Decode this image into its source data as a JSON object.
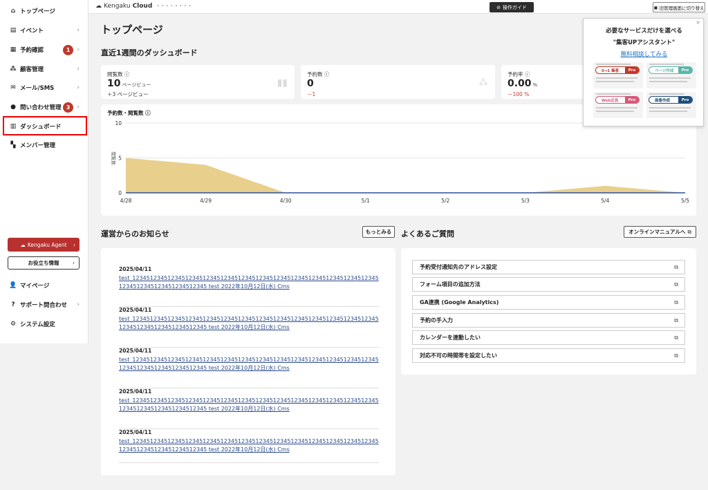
{
  "sidebar": {
    "items": [
      {
        "label": "トップページ",
        "icon": "home-icon"
      },
      {
        "label": "イベント",
        "icon": "document-icon"
      },
      {
        "label": "予約確認",
        "icon": "calendar-icon",
        "badge": "1"
      },
      {
        "label": "顧客管理",
        "icon": "users-icon"
      },
      {
        "label": "メール/SMS",
        "icon": "mail-icon"
      },
      {
        "label": "問い合わせ管理",
        "icon": "chat-icon",
        "badge": "3"
      },
      {
        "label": "ダッシュボード",
        "icon": "chart-icon"
      },
      {
        "label": "メンバー管理",
        "icon": "grid-icon"
      }
    ],
    "agent_label": "Kengaku Agent",
    "useful_label": "お役立ち情報",
    "bottom_items": [
      {
        "label": "マイページ",
        "icon": "person-icon"
      },
      {
        "label": "サポート問合わせ",
        "icon": "help-icon"
      },
      {
        "label": "システム設定",
        "icon": "gear-icon"
      }
    ]
  },
  "topbar": {
    "logo_text": "Kengaku",
    "logo_bold": "Cloud",
    "logo_small": "• • • • • • • •",
    "guide_label": "操作ガイド",
    "switch_label": "旧管理画面に切り替え"
  },
  "main": {
    "page_title": "トップページ",
    "dashboard_title": "直近1週間のダッシュボード",
    "stats": [
      {
        "label": "閲覧数 ⓘ",
        "value": "10",
        "unit": "ページビュー",
        "diff": "＋3 ページビュー",
        "negative": false
      },
      {
        "label": "予約数 ⓘ",
        "value": "0",
        "unit": "",
        "diff": "－1",
        "negative": true
      },
      {
        "label": "予約率 ⓘ",
        "value": "0.00",
        "unit": "%",
        "diff": "－100 %",
        "negative": true
      }
    ],
    "chart_title": "予約数・閲覧数 ⓘ",
    "news_title": "運営からのお知らせ",
    "news_more": "もっとみる",
    "news": [
      {
        "date": "2025/04/11",
        "text": "test_12345123451234512345123451234512345123451234512345123451234512345123451234512345123451234512345 test 2022年10月12日(水) Cms"
      },
      {
        "date": "2025/04/11",
        "text": "test_12345123451234512345123451234512345123451234512345123451234512345123451234512345123451234512345 test 2022年10月12日(水) Cms"
      },
      {
        "date": "2025/04/11",
        "text": "test_12345123451234512345123451234512345123451234512345123451234512345123451234512345123451234512345 test 2022年10月12日(水) Cms"
      },
      {
        "date": "2025/04/11",
        "text": "test_12345123451234512345123451234512345123451234512345123451234512345123451234512345123451234512345 test 2022年10月12日(水) Cms"
      },
      {
        "date": "2025/04/11",
        "text": "test_12345123451234512345123451234512345123451234512345123451234512345123451234512345123451234512345 test 2022年10月12日(水) Cms"
      }
    ],
    "faq_title": "よくあるご質問",
    "manual_label": "オンラインマニュアルへ",
    "faq": [
      "予約受付通知先のアドレス設定",
      "フォーム項目の追加方法",
      "GA連携 (Google Analytics)",
      "予約の手入力",
      "カレンダーを連動したい",
      "対応不可の時間帯を設定したい"
    ]
  },
  "popup": {
    "line1": "必要なサービスだけを選べる",
    "line2": "\"集客UPアシスタント\"",
    "link": "無料相談してみる",
    "cards": [
      {
        "pill": "0→1 集客",
        "pro": "Pro",
        "color": "#c0392b"
      },
      {
        "pill": "ページ作成",
        "pro": "Pro",
        "color": "#5ab5a8"
      },
      {
        "pill": "Web広告",
        "pro": "Pro",
        "color": "#d65a78"
      },
      {
        "pill": "画像作成",
        "pro": "Pro",
        "color": "#1f4f7a"
      }
    ]
  },
  "chart_data": {
    "type": "area",
    "categories": [
      "4/28",
      "4/29",
      "4/30",
      "5/1",
      "5/2",
      "5/3",
      "5/4",
      "5/5"
    ],
    "series": [
      {
        "values": [
          5,
          4,
          0,
          0,
          0,
          0,
          1,
          0
        ],
        "color": "#e8d08c"
      },
      {
        "values": [
          0,
          0,
          0,
          0,
          0,
          0,
          0,
          0
        ],
        "color": "#2b4f9e"
      }
    ],
    "ylabel": "閲覧数",
    "yticks": [
      0,
      5,
      10
    ],
    "ylim": [
      0,
      10
    ]
  }
}
